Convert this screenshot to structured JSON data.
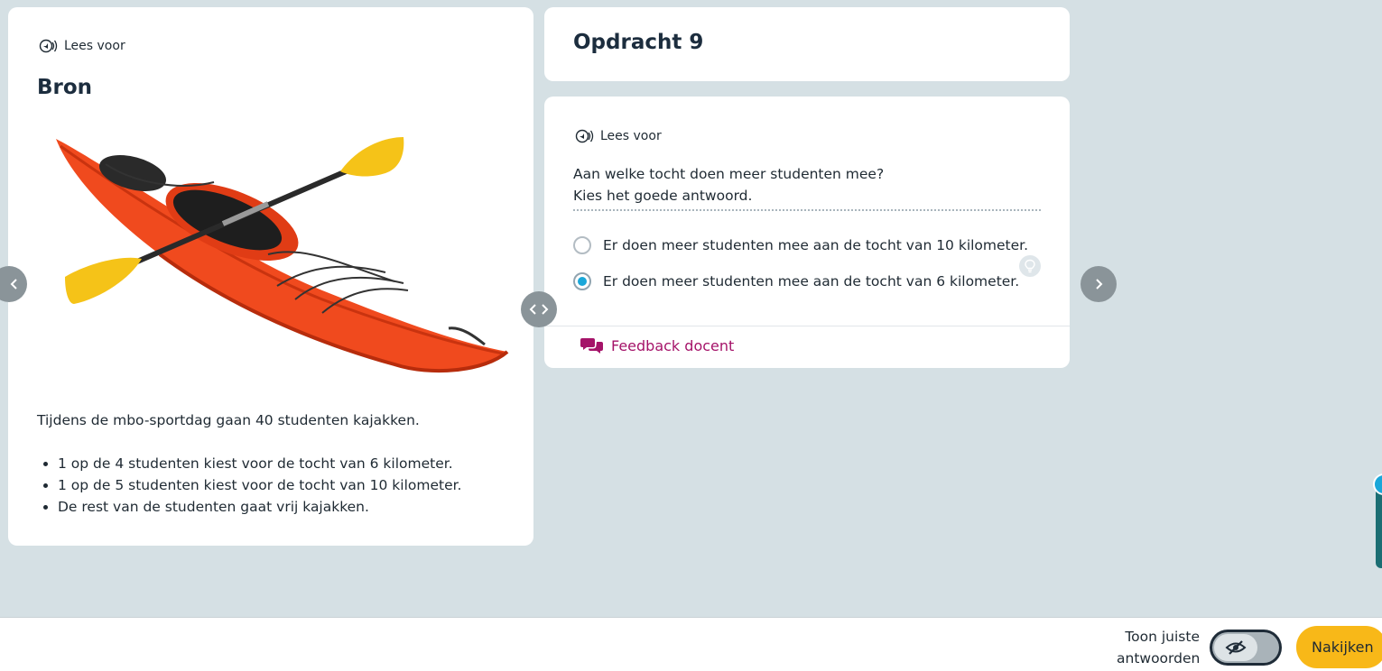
{
  "read_aloud_label": "Lees voor",
  "source": {
    "heading": "Bron",
    "intro": "Tijdens de mbo-sportdag gaan 40 studenten kajakken.",
    "bullets": [
      "1 op de 4 studenten kiest voor de tocht van 6 kilometer.",
      "1 op de 5 studenten kiest voor de tocht van 10 kilometer.",
      "De rest van de studenten gaat vrij kajakken."
    ]
  },
  "assignment": {
    "title": "Opdracht 9",
    "question_line1": "Aan welke tocht doen meer studenten mee?",
    "question_line2": "Kies het goede antwoord.",
    "options": [
      {
        "label": "Er doen meer studenten mee aan de tocht van 10 kilometer.",
        "selected": false
      },
      {
        "label": "Er doen meer studenten mee aan de tocht van 6 kilometer.",
        "selected": true
      }
    ],
    "feedback_label": "Feedback docent"
  },
  "bottom_bar": {
    "toggle_label_line1": "Toon juiste",
    "toggle_label_line2": "antwoorden",
    "toggle_on": false,
    "check_button": "Nakijken"
  },
  "side_tab_badge": "!",
  "colors": {
    "background": "#d5e0e4",
    "feedback": "#a51369",
    "radio_selected": "#1aa7d9",
    "check_button": "#f8b818",
    "kayak": "#f04a1e",
    "paddle_blade": "#f5c318"
  },
  "icons": {
    "read_aloud": "speaker-icon",
    "nav_prev": "chevron-left-icon",
    "nav_next": "chevron-right-icon",
    "split": "split-arrows-icon",
    "hint": "lightbulb-icon",
    "feedback": "chat-bubbles-icon",
    "toggle": "eye-slash-icon"
  }
}
